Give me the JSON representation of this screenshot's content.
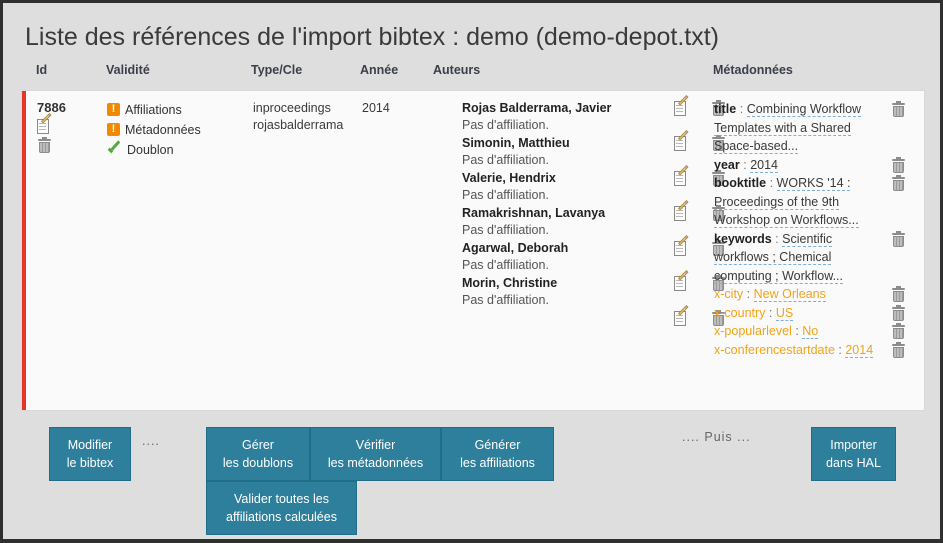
{
  "title": "Liste des références de l'import bibtex : demo (demo-depot.txt)",
  "columns": {
    "id": "Id",
    "validity": "Validité",
    "typecle": "Type/Cle",
    "year": "Année",
    "authors": "Auteurs",
    "metadata": "Métadonnées"
  },
  "colors": {
    "accent": "#2e7f9c",
    "warning": "#f08a00",
    "ok": "#54a93f",
    "row_marker": "#e8352a",
    "xfield": "#f0a417",
    "underline": "#7fb0d8"
  },
  "row": {
    "id": "7886",
    "validity": [
      {
        "status": "warning",
        "label": "Affiliations"
      },
      {
        "status": "warning",
        "label": "Métadonnées"
      },
      {
        "status": "ok",
        "label": "Doublon"
      }
    ],
    "type": "inproceedings",
    "cle": "rojasbalderrama",
    "year": "2014",
    "authors": [
      {
        "name": "Rojas Balderrama, Javier",
        "affiliation": "Pas d'affiliation."
      },
      {
        "name": "Simonin, Matthieu",
        "affiliation": "Pas d'affiliation."
      },
      {
        "name": "Valerie, Hendrix",
        "affiliation": "Pas d'affiliation."
      },
      {
        "name": "Ramakrishnan, Lavanya",
        "affiliation": "Pas d'affiliation."
      },
      {
        "name": "Agarwal, Deborah",
        "affiliation": "Pas d'affiliation."
      },
      {
        "name": "Morin, Christine",
        "affiliation": "Pas d'affiliation."
      }
    ],
    "metadata": [
      {
        "key": "title",
        "sep": ":",
        "value": "Combining Workflow Templates with a Shared Space-based...",
        "x": false
      },
      {
        "key": "year",
        "sep": ":",
        "value": "2014",
        "x": false
      },
      {
        "key": "booktitle",
        "sep": ":",
        "value": "WORKS '14 : Proceedings of the 9th Workshop on Workflows...",
        "x": false
      },
      {
        "key": "keywords",
        "sep": ":",
        "value": "Scientific workflows ; Chemical computing ; Workflow...",
        "x": false
      },
      {
        "key": "x-city",
        "sep": ":",
        "value": "New Orleans",
        "x": true
      },
      {
        "key": "x-country",
        "sep": ":",
        "value": "US",
        "x": true
      },
      {
        "key": "x-popularlevel",
        "sep": ":",
        "value": "No",
        "x": true
      },
      {
        "key": "x-conferencestartdate",
        "sep": ":",
        "value": "2014",
        "x": true
      }
    ]
  },
  "actions": {
    "modifier_l1": "Modifier",
    "modifier_l2": "le bibtex",
    "dots_left": "....",
    "gerer_l1": "Gérer",
    "gerer_l2": "les doublons",
    "verifier_l1": "Vérifier",
    "verifier_l2": "les métadonnées",
    "generer_l1": "Générer",
    "generer_l2": "les affiliations",
    "valider_l1": "Valider toutes les",
    "valider_l2": "affiliations calculées",
    "puis": ".... Puis ...",
    "importer_l1": "Importer",
    "importer_l2": "dans HAL"
  }
}
